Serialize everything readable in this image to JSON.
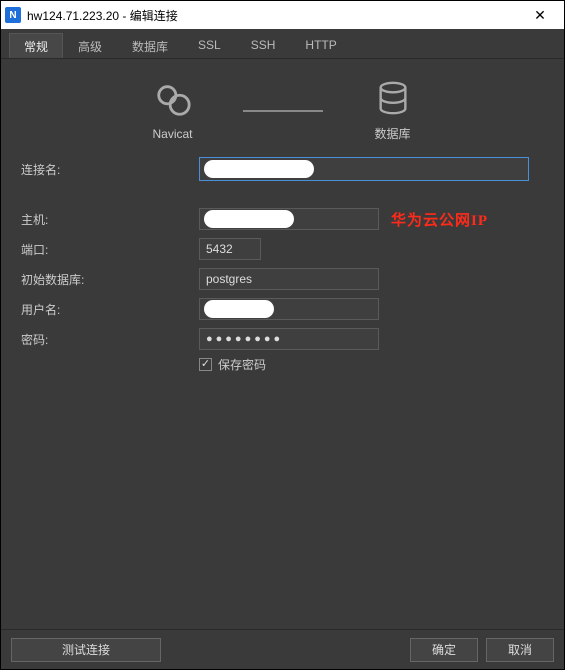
{
  "window": {
    "title": "hw124.71.223.20 - 编辑连接",
    "appicon_letter": "N"
  },
  "tabs": [
    {
      "label": "常规",
      "active": true
    },
    {
      "label": "高级",
      "active": false
    },
    {
      "label": "数据库",
      "active": false
    },
    {
      "label": "SSL",
      "active": false
    },
    {
      "label": "SSH",
      "active": false
    },
    {
      "label": "HTTP",
      "active": false
    }
  ],
  "diagram": {
    "left_label": "Navicat",
    "right_label": "数据库"
  },
  "form": {
    "conn_name_label": "连接名:",
    "conn_name_value": "",
    "host_label": "主机:",
    "host_value": "",
    "host_annotation": "华为云公网IP",
    "port_label": "端口:",
    "port_value": "5432",
    "initdb_label": "初始数据库:",
    "initdb_value": "postgres",
    "user_label": "用户名:",
    "user_value": "",
    "pwd_label": "密码:",
    "pwd_value": "●●●●●●●●",
    "save_pwd_label": "保存密码",
    "save_pwd_checked": true
  },
  "footer": {
    "test_label": "测试连接",
    "ok_label": "确定",
    "cancel_label": "取消"
  }
}
